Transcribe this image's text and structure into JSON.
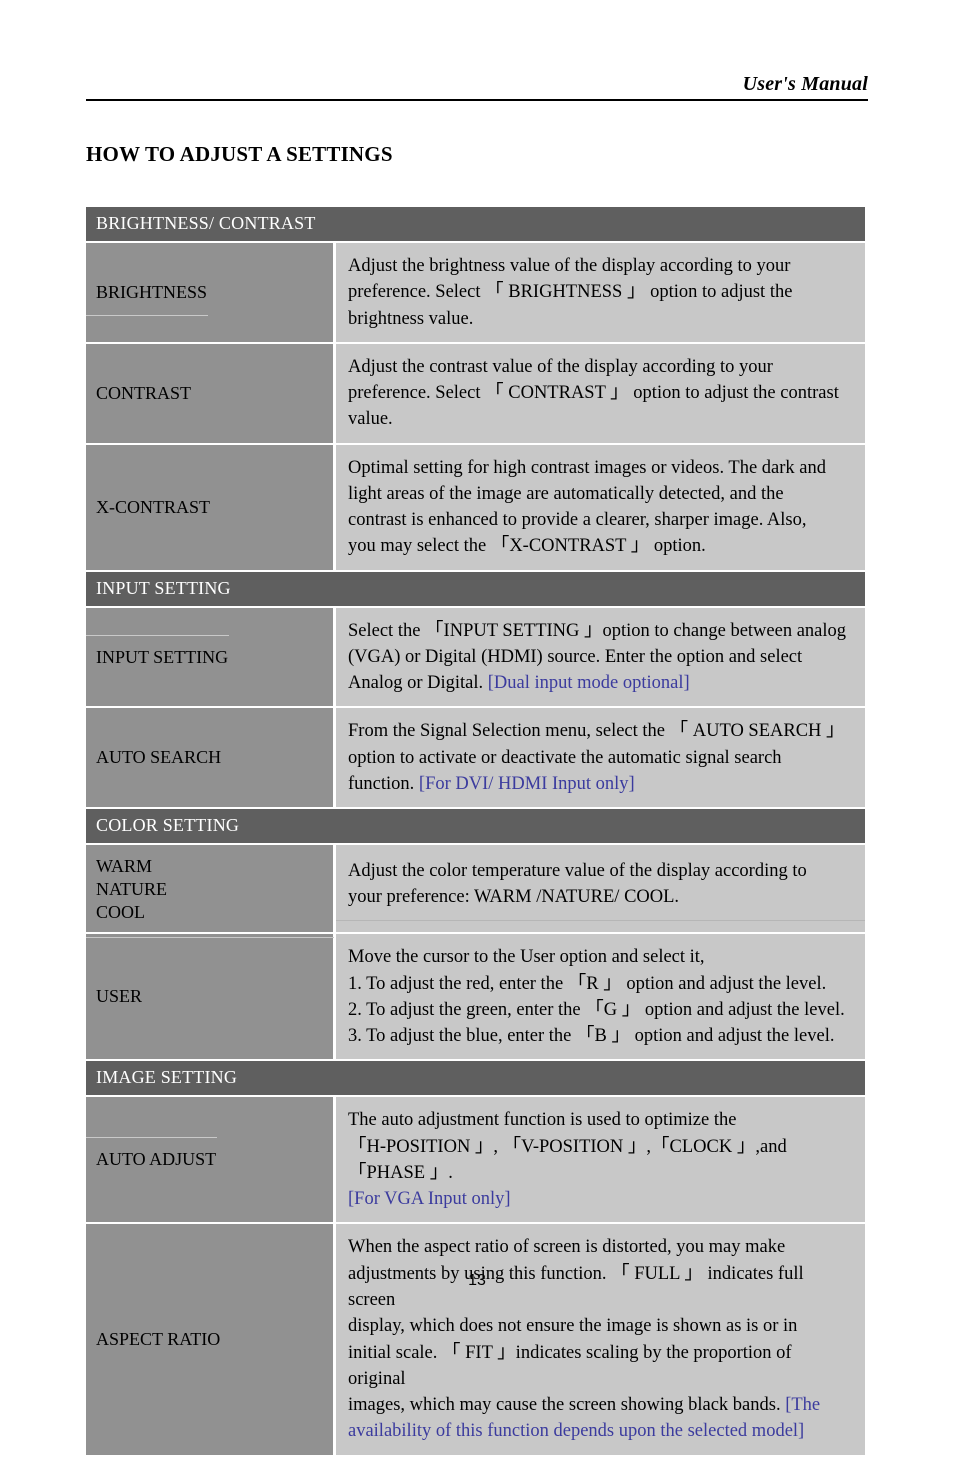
{
  "header": {
    "running_title": "User's Manual"
  },
  "heading": "HOW TO ADJUST A SETTINGS",
  "footer": {
    "page_number": "13"
  },
  "colors": {
    "band": "#5f5f5f",
    "name_cell": "#919191",
    "desc_cell": "#c8c8c8",
    "note_text": "#3b3b9e",
    "page_background": "#ffffff"
  },
  "table": {
    "sections": [
      {
        "band": "BRIGHTNESS/ CONTRAST",
        "rows": [
          {
            "name": "BRIGHTNESS",
            "lines": [
              "Adjust the brightness value of the display according to your",
              "preference. Select 「 BRIGHTNESS 」 option to adjust the",
              "brightness value."
            ]
          },
          {
            "name": "CONTRAST",
            "lines": [
              "Adjust the contrast value of the display according to your",
              "preference. Select 「 CONTRAST 」 option to adjust the contrast",
              "value."
            ]
          },
          {
            "name": "X-CONTRAST",
            "lines": [
              "Optimal setting for high contrast images or videos. The dark and",
              "light areas of the image are automatically detected, and the",
              "contrast is enhanced to provide a clearer, sharper image. Also,",
              "you may select the 「X-CONTRAST 」 option."
            ]
          }
        ]
      },
      {
        "band": "INPUT SETTING",
        "rows": [
          {
            "name": "INPUT SETTING",
            "lines": [
              "Select the 「INPUT SETTING 」option to change between analog",
              "(VGA) or Digital (HDMI) source. Enter the option and select",
              "Analog or Digital."
            ],
            "note": "[Dual input mode optional]",
            "note_inline_after_line": 3
          },
          {
            "name": "AUTO SEARCH",
            "lines": [
              "From the Signal Selection menu, select the  「 AUTO SEARCH 」",
              "option to activate or deactivate the automatic signal search",
              "function."
            ],
            "note": "[For DVI/ HDMI Input only]",
            "note_inline_after_line": 3
          }
        ]
      },
      {
        "band": "COLOR SETTING",
        "rows": [
          {
            "name_lines": [
              "WARM",
              "NATURE",
              "COOL"
            ],
            "lines": [
              "Adjust the color temperature value of the display according to",
              "your preference: WARM /NATURE/ COOL."
            ]
          },
          {
            "name": "USER",
            "lines": [
              "Move the cursor to the User option and select it,",
              "1. To adjust the red, enter the 「R 」 option and adjust the level.",
              "2. To adjust the green, enter the 「G 」 option and adjust the level.",
              "3. To adjust the blue, enter the 「B 」 option and adjust the level."
            ]
          }
        ]
      },
      {
        "band": "IMAGE SETTING",
        "rows": [
          {
            "name": "AUTO ADJUST",
            "lines": [
              "The auto adjustment function is used to optimize the",
              "「H-POSITION 」, 「V-POSITION 」,「CLOCK 」,and 「PHASE 」."
            ],
            "note": "[For VGA Input only]"
          },
          {
            "name": "ASPECT RATIO",
            "lines": [
              "When the aspect ratio of screen is distorted, you may make",
              "adjustments by using this function. 「 FULL 」 indicates full screen",
              "display, which does not ensure the image is shown as is or in",
              "initial scale. 「 FIT 」indicates scaling by the proportion of original",
              "images, which may cause the screen showing black bands."
            ],
            "note": "[The availability of this function depends upon the selected model]",
            "note_part_1": "[The",
            "note_part_2": "availability of this function depends upon the selected model]"
          }
        ]
      }
    ]
  }
}
